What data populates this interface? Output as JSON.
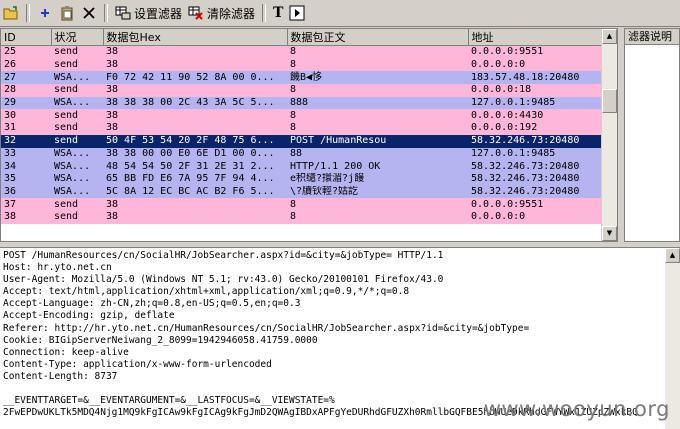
{
  "toolbar": {
    "set_filter_label": "设置滤器",
    "clear_filter_label": "清除滤器",
    "text_button_label": "T"
  },
  "packet_list": {
    "columns": [
      "ID",
      "状况",
      "数据包Hex",
      "数据包正文",
      "地址"
    ],
    "rows": [
      {
        "id": "25",
        "status": "send",
        "hex": "38",
        "body": "8",
        "addr": "0.0.0.0:9551",
        "kind": "send"
      },
      {
        "id": "26",
        "status": "send",
        "hex": "38",
        "body": "8",
        "addr": "0.0.0.0:0",
        "kind": "send"
      },
      {
        "id": "27",
        "status": "WSA...",
        "hex": "F0 72 42 11 90 52 8A 00 0...",
        "body": "饑B◀恀",
        "addr": "183.57.48.18:20480",
        "kind": "wsa"
      },
      {
        "id": "28",
        "status": "send",
        "hex": "38",
        "body": "8",
        "addr": "0.0.0.0:18",
        "kind": "send"
      },
      {
        "id": "29",
        "status": "WSA...",
        "hex": "38 38 38 00 2C 43 3A 5C 5...",
        "body": "888",
        "addr": "127.0.0.1:9485",
        "kind": "wsa"
      },
      {
        "id": "30",
        "status": "send",
        "hex": "38",
        "body": "8",
        "addr": "0.0.0.0:4430",
        "kind": "send"
      },
      {
        "id": "31",
        "status": "send",
        "hex": "38",
        "body": "8",
        "addr": "0.0.0.0:192",
        "kind": "send"
      },
      {
        "id": "32",
        "status": "send",
        "hex": "50 4F 53 54 20 2F 48 75 6...",
        "body": "POST /HumanResou",
        "addr": "58.32.246.73:20480",
        "kind": "sel"
      },
      {
        "id": "33",
        "status": "WSA...",
        "hex": "38 38 00 00 E0 6E D1 00 0...",
        "body": "88",
        "addr": "127.0.0.1:9485",
        "kind": "wsa"
      },
      {
        "id": "34",
        "status": "WSA...",
        "hex": "48 54 54 50 2F 31 2E 31 2...",
        "body": "HTTP/1.1 200 OK",
        "addr": "58.32.246.73:20480",
        "kind": "wsa"
      },
      {
        "id": "35",
        "status": "WSA...",
        "hex": "65 BB FD E6 7A 95 7F 94 4...",
        "body": "e积缱?擐湄?j饅",
        "addr": "58.32.246.73:20480",
        "kind": "wsa"
      },
      {
        "id": "36",
        "status": "WSA...",
        "hex": "5C 8A 12 EC BC AC B2 F6 5...",
        "body": "\\?牘钬輕?姑訖",
        "addr": "58.32.246.73:20480",
        "kind": "wsa"
      },
      {
        "id": "37",
        "status": "send",
        "hex": "38",
        "body": "8",
        "addr": "0.0.0.0:9551",
        "kind": "send"
      },
      {
        "id": "38",
        "status": "send",
        "hex": "38",
        "body": "8",
        "addr": "0.0.0.0:0",
        "kind": "send"
      }
    ]
  },
  "filter_pane": {
    "header": "滤器说明"
  },
  "detail": {
    "lines": [
      "POST /HumanResources/cn/SocialHR/JobSearcher.aspx?id=&city=&jobType= HTTP/1.1",
      "Host: hr.yto.net.cn",
      "User-Agent: Mozilla/5.0 (Windows NT 5.1; rv:43.0) Gecko/20100101 Firefox/43.0",
      "Accept: text/html,application/xhtml+xml,application/xml;q=0.9,*/*;q=0.8",
      "Accept-Language: zh-CN,zh;q=0.8,en-US;q=0.5,en;q=0.3",
      "Accept-Encoding: gzip, deflate",
      "Referer: http://hr.yto.net.cn/HumanResources/cn/SocialHR/JobSearcher.aspx?id=&city=&jobType=",
      "Cookie: BIGipServerNeiwang_2_8099=1942946058.41759.0000",
      "Connection: keep-alive",
      "Content-Type: application/x-www-form-urlencoded",
      "Content-Length: 8737",
      "",
      "__EVENTTARGET=&__EVENTARGUMENT=&__LASTFOCUS=&__VIEWSTATE=%",
      "2FwEPDwUKLTk5MDQ4Njg1MQ9kFgICAw9kFgICAg9kFgJmD2QWAgIBDxAPFgYeDURhdGFUZXh0RmllbGQFBE5hbWUeDkRhdGFWYWx1ZUZpZWxkBQ"
    ]
  },
  "watermark": "www.wooyun.org"
}
